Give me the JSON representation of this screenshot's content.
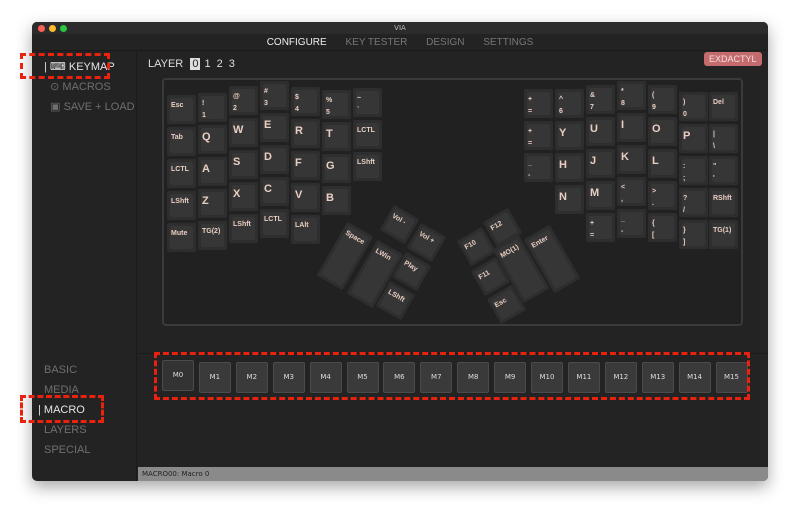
{
  "window": {
    "title": "VIA"
  },
  "nav": {
    "tabs": [
      "CONFIGURE",
      "KEY TESTER",
      "DESIGN",
      "SETTINGS"
    ],
    "active": 0
  },
  "sidebar": {
    "top": [
      {
        "label": "KEYMAP",
        "icon": "keyboard-icon"
      },
      {
        "label": "MACROS",
        "icon": "record-icon"
      },
      {
        "label": "SAVE + LOAD",
        "icon": "floppy-icon"
      }
    ],
    "categories": [
      "BASIC",
      "MEDIA",
      "MACRO",
      "LAYERS",
      "SPECIAL"
    ],
    "active_category": "MACRO"
  },
  "layer": {
    "label": "LAYER",
    "options": [
      "0",
      "1",
      "2",
      "3"
    ],
    "selected": "0"
  },
  "keyboard_name": "EXDACTYL",
  "keys": {
    "left": [
      [
        "Esc",
        "Tab",
        "LCTL",
        "LShft",
        "Mute"
      ],
      [
        "!\n1",
        "Q",
        "A",
        "Z",
        "TG(2)"
      ],
      [
        "@\n2",
        "W",
        "S",
        "X",
        "LShft"
      ],
      [
        "#\n3",
        "E",
        "D",
        "C",
        "LCTL"
      ],
      [
        "$\n4",
        "R",
        "F",
        "V",
        "LAlt"
      ],
      [
        "%\n5",
        "T",
        "G",
        "B"
      ],
      [
        "~\n`",
        "LCTL",
        "LShft"
      ]
    ],
    "right": [
      [
        "+\n=",
        "+\n=",
        "_\n-"
      ],
      [
        "^\n6",
        "Y",
        "H",
        "N"
      ],
      [
        "&\n7",
        "U",
        "J",
        "M",
        "+\n="
      ],
      [
        "*\n8",
        "I",
        "K",
        "<\n,",
        "_\n-"
      ],
      [
        "(\n9",
        "O",
        "L",
        ">\n.",
        "{\n["
      ],
      [
        ")\n0",
        "P",
        ":\n;",
        "?\n/",
        "}\n]"
      ],
      [
        "Del",
        "|\n\\",
        "\"\n'",
        "RShft",
        "TG(1)"
      ]
    ],
    "left_thumb": [
      "Space",
      "LWin",
      "Vol -",
      "Vol +",
      "Play",
      "LShft"
    ],
    "right_thumb": [
      "F10",
      "F12",
      "F11",
      "MO(1)",
      "Enter",
      "Esc"
    ]
  },
  "macros": [
    "M0",
    "M1",
    "M2",
    "M3",
    "M4",
    "M5",
    "M6",
    "M7",
    "M8",
    "M9",
    "M10",
    "M11",
    "M12",
    "M13",
    "M14",
    "M15"
  ],
  "status": "MACRO00: Macro 0",
  "colors": {
    "accent": "#e8220f",
    "badge": "#c46b6e",
    "legend": "#e9cfc3"
  }
}
